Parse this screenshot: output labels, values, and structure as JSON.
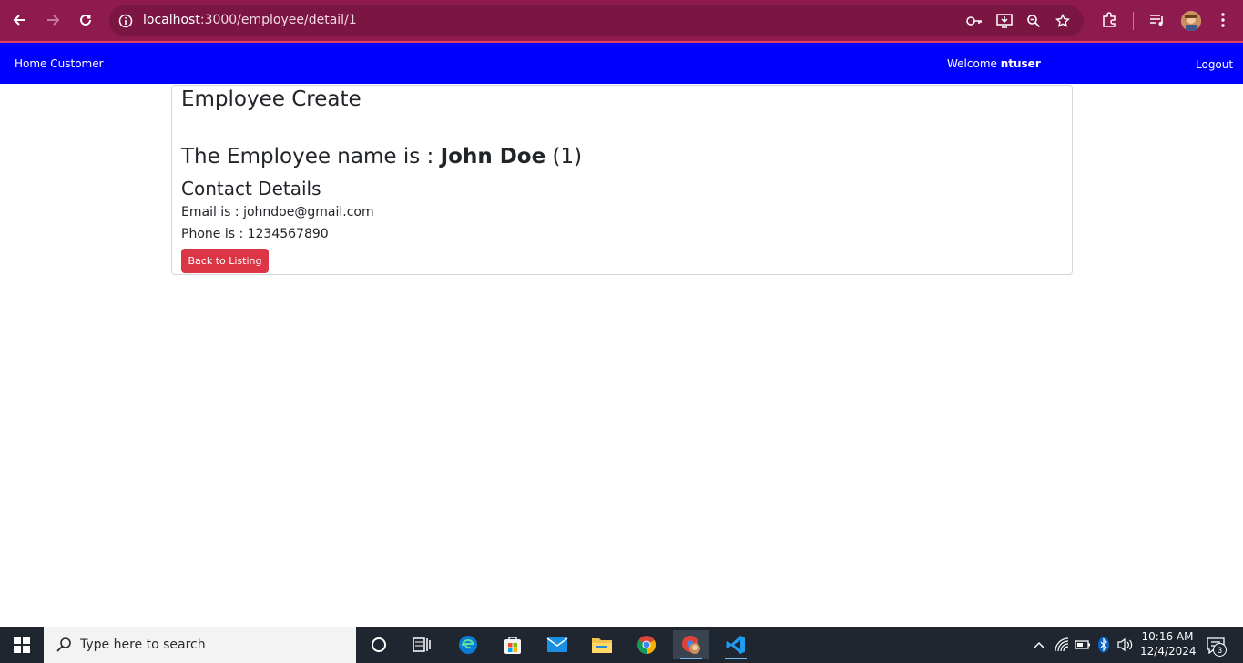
{
  "browser": {
    "url_host": "localhost",
    "url_path": ":3000/employee/detail/1",
    "colors": {
      "chrome": "#8e1a4e",
      "omnibox": "#7a1641"
    }
  },
  "navbar": {
    "brand": "Home Customer",
    "welcome_prefix": "Welcome",
    "username": "ntuser",
    "logout": "Logout",
    "color": "#0000ff"
  },
  "card": {
    "title": "Employee Create",
    "name_prefix": "The Employee name is :",
    "name": "John Doe",
    "id": "(1)",
    "contact_heading": "Contact Details",
    "email_text": "Email is : johndoe@gmail.com",
    "phone_text": "Phone is : 1234567890",
    "back_button": "Back to Listing",
    "button_color": "#dc3545"
  },
  "taskbar": {
    "search_placeholder": "Type here to search",
    "time": "10:16 AM",
    "date": "12/4/2024",
    "notification_count": "3",
    "apps": [
      "cortana-icon",
      "task-view-icon",
      "edge-icon",
      "store-icon",
      "mail-icon",
      "file-explorer-icon",
      "chrome-icon",
      "chrome-profile-icon",
      "vscode-icon"
    ]
  }
}
